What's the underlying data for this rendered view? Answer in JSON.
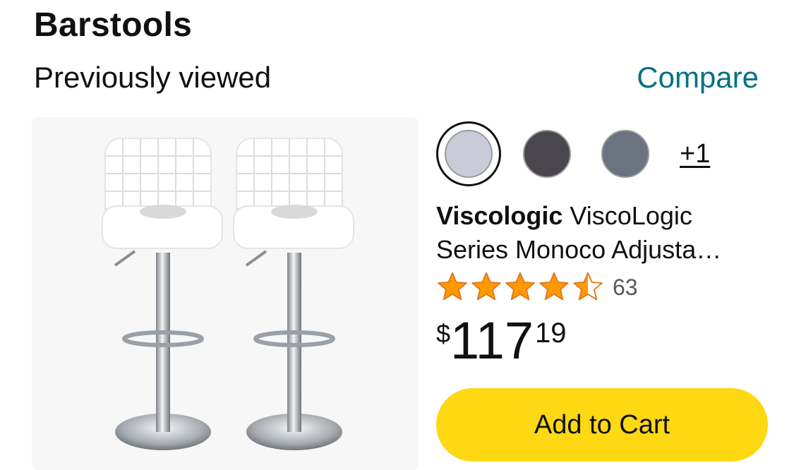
{
  "section": {
    "title": "Barstools",
    "subtitle": "Previously viewed",
    "compare_label": "Compare"
  },
  "product": {
    "swatches": [
      {
        "color": "#c9ccd6",
        "selected": true
      },
      {
        "color": "#4a464d",
        "selected": false
      },
      {
        "color": "#6b7280",
        "selected": false
      }
    ],
    "more_swatches_label": "+1",
    "brand": "Viscologic",
    "title_line1": "ViscoLogic",
    "title_line2": "Series Monoco Adjusta…",
    "rating": 4.5,
    "review_count": "63",
    "price": {
      "symbol": "$",
      "whole": "117",
      "fraction": "19"
    },
    "add_to_cart_label": "Add to Cart"
  },
  "colors": {
    "link": "#007185",
    "button": "#ffd814",
    "star": "#ff9900"
  }
}
